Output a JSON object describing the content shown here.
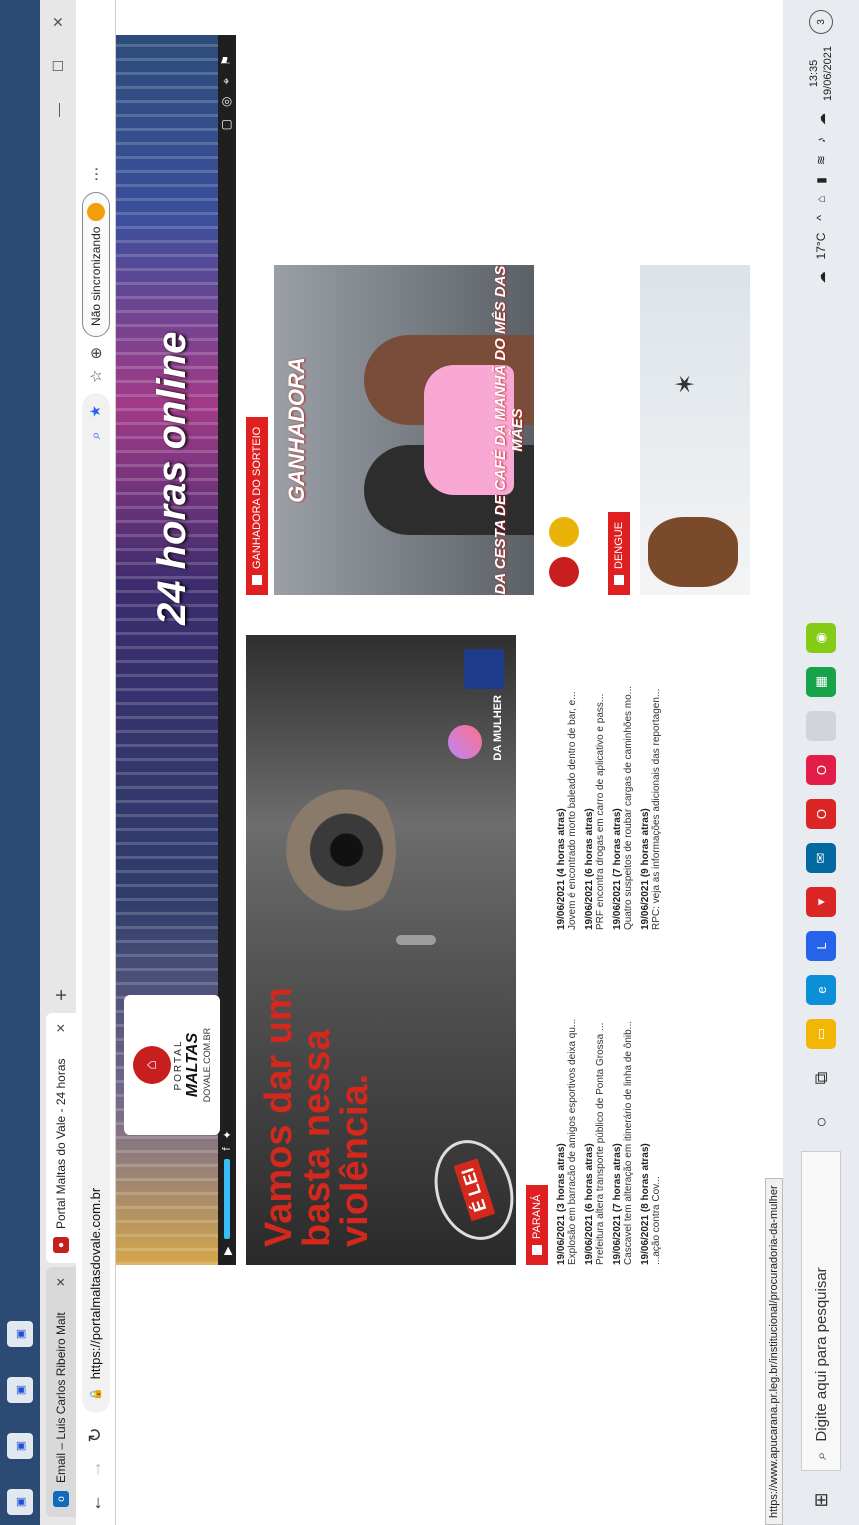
{
  "browser": {
    "tabs": [
      {
        "label": "Email – Luis Carlos Ribeiro Malt",
        "favicon": "outlook-icon"
      },
      {
        "label": "Portal Maltas do Vale - 24 horas",
        "favicon": "portal-icon"
      }
    ],
    "new_tab_label": "+",
    "url": "https://portalmaltasdovale.com.br",
    "sync_label": "Não sincronizando"
  },
  "site": {
    "logo_line1": "PORTAL",
    "logo_line2": "MALTAS",
    "logo_line3": "DOVALE.COM.BR",
    "slogan": "24 horas online"
  },
  "banner": {
    "headline": "Vamos dar um basta nessa violência.",
    "stamp": "É LEI",
    "brand": "DA MULHER"
  },
  "sections": {
    "parana": "PARANÁ",
    "ganhadora": "GANHADORA DO SORTEIO",
    "dengue": "DENGUE"
  },
  "news": [
    {
      "date": "19/06/2021 (3 horas atras)",
      "title": "Explosão em barracão de amigos esportivos deixa qu..."
    },
    {
      "date": "19/06/2021 (4 horas atras)",
      "title": "Jovem é encontrado morto baleado dentro de bar, e..."
    },
    {
      "date": "19/06/2021 (6 horas atras)",
      "title": "Prefeitura altera transporte público de Ponta Grossa ..."
    },
    {
      "date": "19/06/2021 (6 horas atras)",
      "title": "PRF encontra drogas em carro de aplicativo e pass..."
    },
    {
      "date": "19/06/2021 (7 horas atras)",
      "title": "Cascavel tem alteração em itinerário de linha de ônib..."
    },
    {
      "date": "19/06/2021 (7 horas atras)",
      "title": "Quatro suspeitos de roubar cargas de caminhões mo..."
    },
    {
      "date": "19/06/2021 (8 horas atras)",
      "title": "...ação contra Cov..."
    },
    {
      "date": "19/06/2021 (9 horas atras)",
      "title": "RPC: veja as informações adicionais das reportagen..."
    }
  ],
  "promo": {
    "line1": "GANHADORA",
    "line2": "DA CESTA DE CAFÉ DA MANHÃ DO MÊS DAS MÃES"
  },
  "status_url": "https://www.apucarana.pr.leg.br/institucional/procuradoria-da-mulher",
  "taskbar": {
    "search_placeholder": "Digite aqui para pesquisar",
    "temperature": "17°C",
    "time": "13:35",
    "date": "19/06/2021",
    "notifications": "3"
  }
}
